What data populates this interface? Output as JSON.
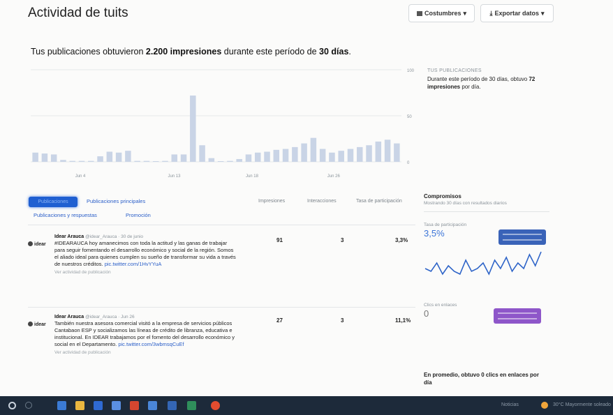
{
  "header": {
    "title": "Actividad de tuits",
    "custom_button": "Costumbres",
    "export_button": "Exportar datos"
  },
  "summary": {
    "prefix": "Tus publicaciones obtuvieron ",
    "impressions": "2.200 impresiones",
    "middle": " durante este período de ",
    "days": "30 días",
    "suffix": "."
  },
  "chart_data": {
    "type": "bar",
    "title": "",
    "series": [
      {
        "name": "",
        "values": [
          10,
          9,
          8,
          2,
          1,
          1,
          1,
          6,
          11,
          10,
          12,
          1,
          1,
          0,
          1,
          8,
          8,
          72,
          18,
          4,
          0,
          1,
          3,
          8,
          10,
          11,
          13,
          14,
          16,
          20,
          26,
          14,
          10,
          12,
          14,
          16,
          18,
          22,
          24,
          20
        ]
      }
    ],
    "x_tick_labels": [
      "Jun 4",
      "Jun 13",
      "Jun 18",
      "Jun 26"
    ],
    "y_tick_labels": [
      "100",
      "50",
      "0"
    ],
    "y_range": [
      0,
      100
    ],
    "grid": true
  },
  "legend": {
    "key": "TUS PUBLICACIONES",
    "text_prefix": "Durante este período de 30 días, obtuvo ",
    "value": "72 impresiones",
    "text_suffix": " por día."
  },
  "tabs": {
    "active": "Publicaciones",
    "top": "Publicaciones principales",
    "replies": "Publicaciones y respuestas",
    "promoted": "Promoción"
  },
  "columns": {
    "impressions": "Impresiones",
    "interactions": "Interacciones",
    "rate": "Tasa de participación"
  },
  "tweets": [
    {
      "avatar": "idear",
      "author": "Idear Arauca",
      "handle": "@idear_Arauca · 30 de junio",
      "text": "#IDEARAUCA hoy amanecimos con toda la actitud y las ganas de trabajar para seguir fomentando el desarrollo económico y social de la región. Somos el aliado ideal para quienes cumplen su sueño de transformar su vida a través de nuestros créditos.",
      "link": "pic.twitter.com/1HvYYuA",
      "activity": "Ver actividad de publicación",
      "impressions": "91",
      "interactions": "3",
      "rate": "3,3%"
    },
    {
      "avatar": "idear",
      "author": "Idear Arauca",
      "handle": "@idear_Arauca · Jun 26",
      "text": "También nuestra asesora comercial visitó a la empresa de servicios públicos Cantabaon ESP y socializamos las líneas de crédito de libranza, educativa e institucional. En IDEAR trabajamos por el fomento del desarrollo económico y social en el Departamento.",
      "link": "pic.twitter.com/3wbmsqCuEf",
      "activity": "Ver actividad de publicación",
      "impressions": "27",
      "interactions": "3",
      "rate": "11,1%"
    }
  ],
  "engagement": {
    "title": "Compromisos",
    "subtitle": "Mostrando 30 días con resultados diarios",
    "rate_label": "Tasa de participación",
    "rate_value": "3,5%",
    "clicks_label": "Clics en enlaces",
    "clicks_value": "0",
    "average": "En promedio, obtuvo 0 clics en enlaces por día",
    "sparkline": [
      3,
      2,
      5,
      1,
      4,
      2,
      1,
      6,
      2,
      3,
      5,
      1,
      6,
      3,
      7,
      2,
      5,
      3,
      8,
      4,
      9
    ]
  },
  "taskbar": {
    "tray_text": "Noticias",
    "tray_weather": "30°C Mayormente soleado"
  }
}
